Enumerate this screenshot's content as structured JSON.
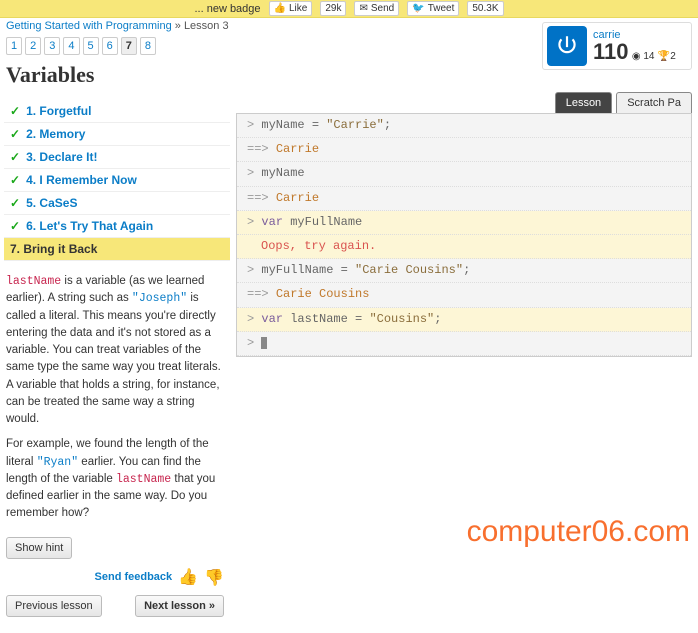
{
  "topbar": {
    "text": "... new badge",
    "like_label": "Like",
    "like_count": "29k",
    "send_label": "Send",
    "tweet_label": "Tweet",
    "tweet_count": "50.3K"
  },
  "breadcrumb": {
    "a": "Getting Started with Programming",
    "sep": " » ",
    "b": "Lesson 3"
  },
  "pager": {
    "items": [
      "1",
      "2",
      "3",
      "4",
      "5",
      "6",
      "7",
      "8"
    ],
    "active": 6
  },
  "section_title": "Variables",
  "lessons": {
    "items": [
      {
        "num": "1.",
        "label": "Forgetful",
        "done": true
      },
      {
        "num": "2.",
        "label": "Memory",
        "done": true
      },
      {
        "num": "3.",
        "label": "Declare It!",
        "done": true
      },
      {
        "num": "4.",
        "label": "I Remember Now",
        "done": true
      },
      {
        "num": "5.",
        "label": "CaSeS",
        "done": true
      },
      {
        "num": "6.",
        "label": "Let's Try That Again",
        "done": true
      },
      {
        "num": "7.",
        "label": "Bring it Back",
        "done": false,
        "current": true
      }
    ]
  },
  "body": {
    "p1a": "lastName",
    "p1b": " is a variable (as we learned earlier). A string such as ",
    "p1c": "\"Joseph\"",
    "p1d": " is called a literal. This means you're directly entering the data and it's not stored as a variable. You can treat variables of the same type the same way you treat literals. A variable that holds a string, for instance, can be treated the same way a string would.",
    "p2a": "For example, we found the length of the literal ",
    "p2b": "\"Ryan\"",
    "p2c": " earlier. You can find the length of the variable ",
    "p2d": "lastName",
    "p2e": " that you defined earlier in the same way. Do you remember how?"
  },
  "buttons": {
    "show_hint": "Show hint",
    "send_feedback": "Send feedback",
    "prev": "Previous lesson",
    "next": "Next lesson »"
  },
  "profile": {
    "username": "carrie",
    "score": "110",
    "medals": "14",
    "trophies": "2"
  },
  "tabs": {
    "lesson": "Lesson",
    "scratch": "Scratch Pa"
  },
  "console": {
    "l0_prompt": "> ",
    "l0": "myName = ",
    "l0s": "\"Carrie\"",
    "l0e": ";",
    "l1_prompt": "==> ",
    "l1": "Carrie",
    "l2_prompt": "> ",
    "l2": "myName",
    "l3_prompt": "==> ",
    "l3": "Carrie",
    "l4_prompt": "> ",
    "l4a": "var",
    "l4b": " myFullName",
    "l5": "Oops, try again.",
    "l6_prompt": "> ",
    "l6a": "myFullName = ",
    "l6b": "\"Carie Cousins\"",
    "l6c": ";",
    "l7_prompt": "==> ",
    "l7": "Carie Cousins",
    "l8_prompt": "> ",
    "l8a": "var",
    "l8b": " lastName = ",
    "l8c": "\"Cousins\"",
    "l8d": ";",
    "l9_prompt": "> "
  },
  "watermark": "computer06.com"
}
